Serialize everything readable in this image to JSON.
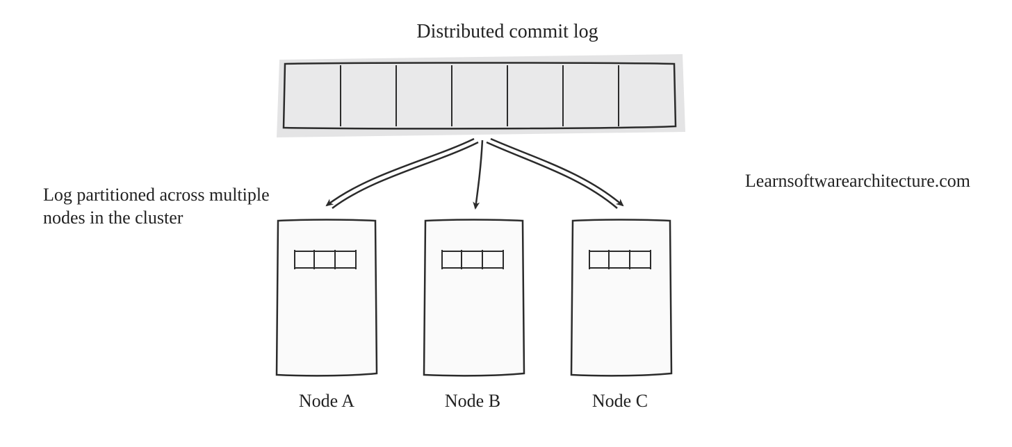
{
  "title": "Distributed commit log",
  "caption": "Log partitioned across multiple nodes in the cluster",
  "attribution": "Learnsoftwarearchitecture.com",
  "nodes": {
    "a": {
      "label": "Node A"
    },
    "b": {
      "label": "Node B"
    },
    "c": {
      "label": "Node C"
    }
  },
  "commit_log": {
    "segments": 7
  },
  "colors": {
    "stroke": "#2b2b2b",
    "fill_light": "#e9e9ea",
    "node_fill": "#fafafa",
    "shadow": "#e4e4e5"
  }
}
